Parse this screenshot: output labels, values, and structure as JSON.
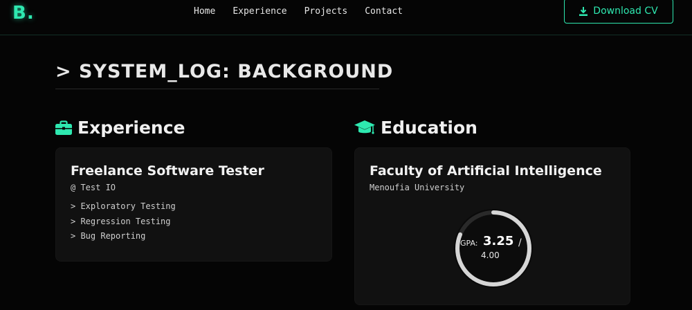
{
  "nav": {
    "logo": "B.",
    "links": [
      "Home",
      "Experience",
      "Projects",
      "Contact"
    ],
    "cta_label": "Download CV"
  },
  "section_title": "> SYSTEM_LOG: BACKGROUND",
  "experience": {
    "heading": "Experience",
    "card": {
      "title": "Freelance Software Tester",
      "company": "@ Test IO",
      "skills": [
        "> Exploratory Testing",
        "> Regression Testing",
        "> Bug Reporting"
      ]
    }
  },
  "education": {
    "heading": "Education",
    "card": {
      "title": "Faculty of Artificial Intelligence",
      "university": "Menoufia University",
      "gpa_label": "GPA:",
      "gpa_value": "3.25",
      "gpa_separator": "/",
      "gpa_max": "4.00",
      "gpa_fraction": 0.8125
    }
  },
  "colors": {
    "accent": "#2ee8b0",
    "background": "#050505",
    "card": "#111111"
  }
}
